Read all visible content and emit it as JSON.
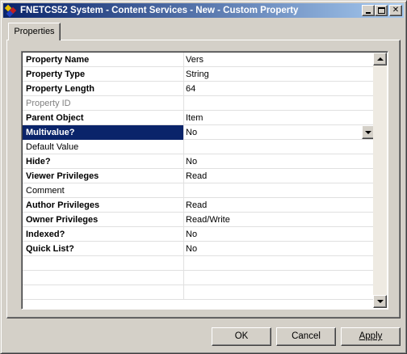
{
  "window": {
    "title": "FNETCS52 System - Content Services - New - Custom Property",
    "app_icon": "filenet-icon",
    "controls": {
      "minimize": "minimize-icon",
      "maximize": "maximize-icon",
      "close": "close-icon"
    }
  },
  "tabs": [
    {
      "label": "Properties",
      "active": true
    }
  ],
  "properties": [
    {
      "name": "Property Name",
      "value": "Vers",
      "bold": true,
      "disabled": false
    },
    {
      "name": "Property Type",
      "value": "String",
      "bold": true,
      "disabled": false
    },
    {
      "name": "Property Length",
      "value": "64",
      "bold": true,
      "disabled": false
    },
    {
      "name": "Property ID",
      "value": "",
      "bold": false,
      "disabled": true
    },
    {
      "name": "Parent Object",
      "value": "Item",
      "bold": true,
      "disabled": false
    },
    {
      "name": "Multivalue?",
      "value": "No",
      "bold": true,
      "disabled": false,
      "selected": true,
      "dropdown": true
    },
    {
      "name": "Default Value",
      "value": "",
      "bold": false,
      "disabled": false
    },
    {
      "name": "Hide?",
      "value": "No",
      "bold": true,
      "disabled": false
    },
    {
      "name": "Viewer Privileges",
      "value": "Read",
      "bold": true,
      "disabled": false
    },
    {
      "name": "Comment",
      "value": "",
      "bold": false,
      "disabled": false
    },
    {
      "name": "Author Privileges",
      "value": "Read",
      "bold": true,
      "disabled": false
    },
    {
      "name": "Owner Privileges",
      "value": "Read/Write",
      "bold": true,
      "disabled": false
    },
    {
      "name": "Indexed?",
      "value": "No",
      "bold": true,
      "disabled": false
    },
    {
      "name": "Quick List?",
      "value": "No",
      "bold": true,
      "disabled": false
    }
  ],
  "buttons": {
    "ok": "OK",
    "cancel": "Cancel",
    "apply": "Apply"
  },
  "colors": {
    "title_gradient_start": "#0a246a",
    "title_gradient_end": "#a6caf0",
    "selection": "#0a246a",
    "face": "#d4d0c8"
  }
}
